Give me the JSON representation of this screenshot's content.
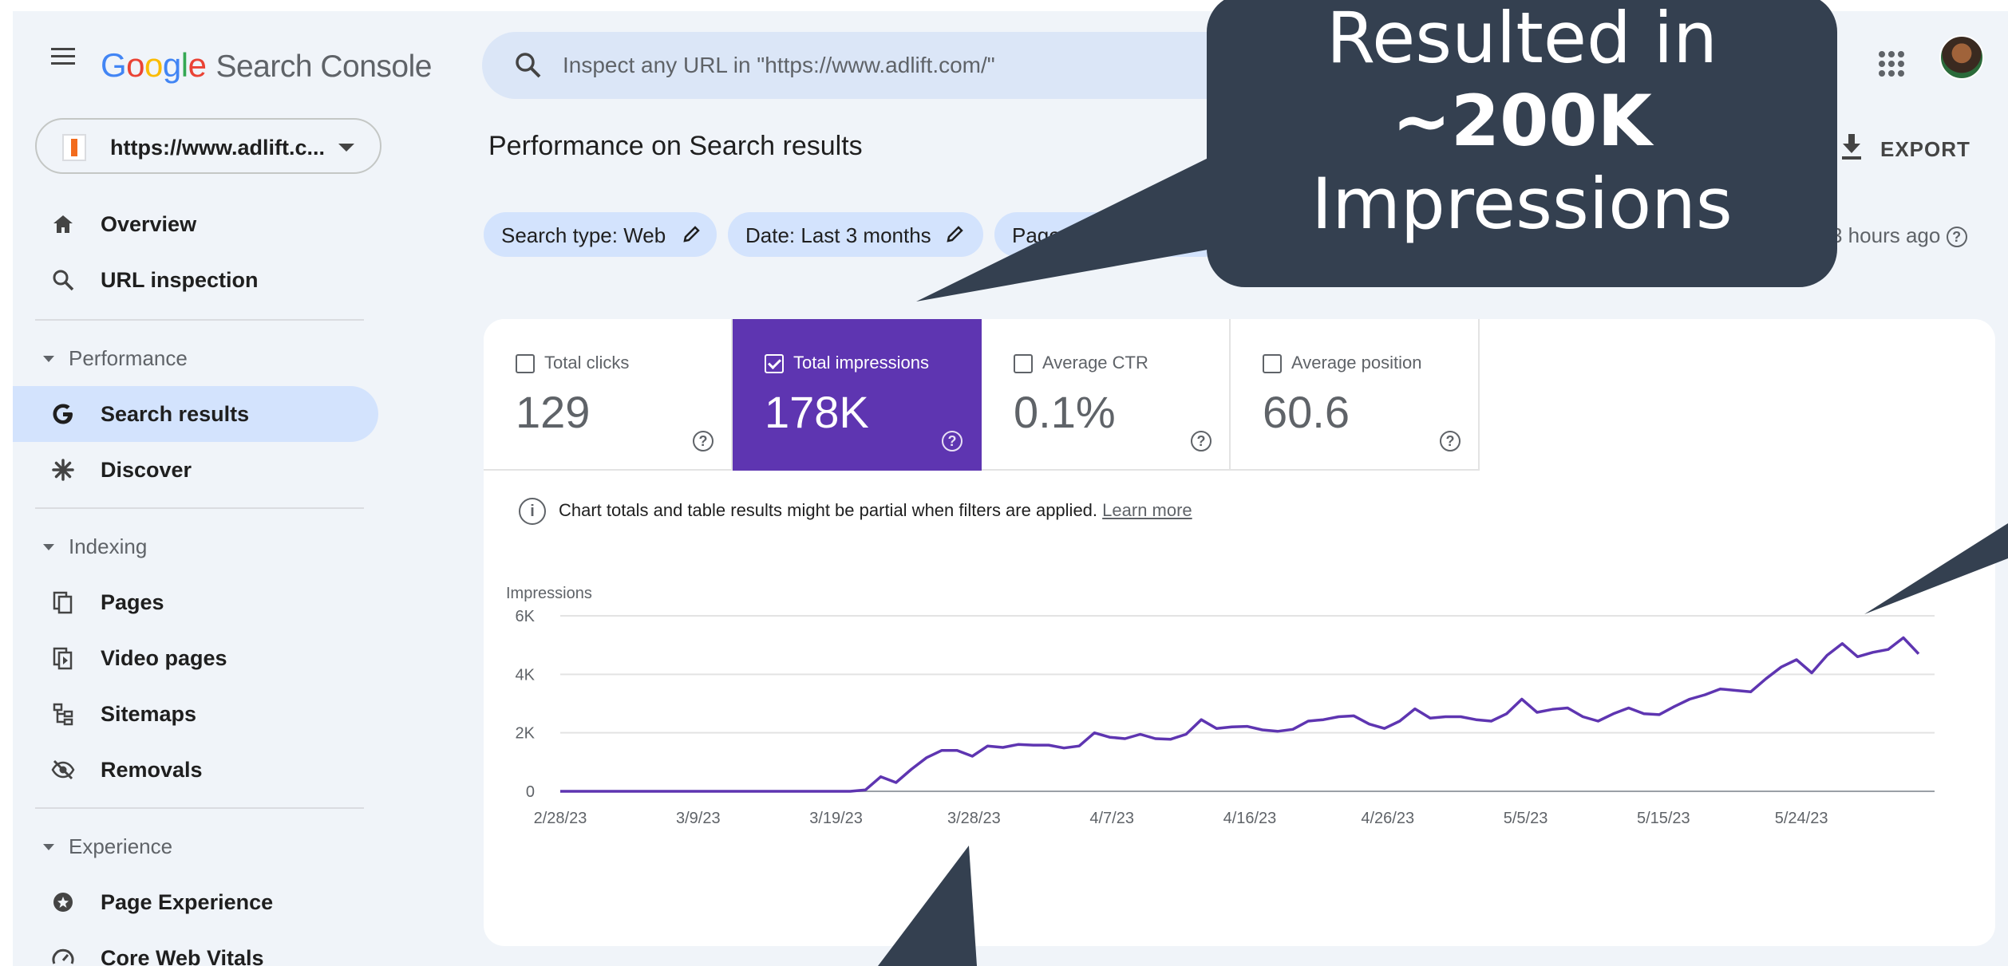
{
  "header": {
    "logo_letters": [
      "G",
      "o",
      "o",
      "g",
      "l",
      "e"
    ],
    "product": "Search Console",
    "search_placeholder": "Inspect any URL in \"https://www.adlift.com/\""
  },
  "property": {
    "label": "https://www.adlift.c..."
  },
  "sidebar": {
    "top_items": [
      {
        "label": "Overview",
        "icon": "home-icon"
      },
      {
        "label": "URL inspection",
        "icon": "search-icon"
      }
    ],
    "sections": [
      {
        "title": "Performance",
        "items": [
          {
            "label": "Search results",
            "icon": "google-g-icon",
            "active": true
          },
          {
            "label": "Discover",
            "icon": "asterisk-icon"
          }
        ]
      },
      {
        "title": "Indexing",
        "items": [
          {
            "label": "Pages",
            "icon": "pages-icon"
          },
          {
            "label": "Video pages",
            "icon": "video-pages-icon"
          },
          {
            "label": "Sitemaps",
            "icon": "sitemap-icon"
          },
          {
            "label": "Removals",
            "icon": "eye-off-icon"
          }
        ]
      },
      {
        "title": "Experience",
        "items": [
          {
            "label": "Page Experience",
            "icon": "page-experience-icon"
          },
          {
            "label": "Core Web Vitals",
            "icon": "gauge-icon"
          }
        ]
      }
    ]
  },
  "main": {
    "title": "Performance on Search results",
    "export_label": "EXPORT",
    "filters": [
      {
        "label": "Search type: Web"
      },
      {
        "label": "Date: Last 3 months"
      },
      {
        "label": "Page:"
      }
    ],
    "updated": "3 hours ago",
    "metrics": [
      {
        "label": "Total clicks",
        "value": "129",
        "selected": false
      },
      {
        "label": "Total impressions",
        "value": "178K",
        "selected": true
      },
      {
        "label": "Average CTR",
        "value": "0.1%",
        "selected": false
      },
      {
        "label": "Average position",
        "value": "60.6",
        "selected": false
      }
    ],
    "info_text": "Chart totals and table results might be partial when filters are applied.",
    "learn_more": "Learn more"
  },
  "callout": {
    "line1": "Resulted in",
    "line2": "~200K",
    "line3": "Impressions"
  },
  "colors": {
    "accent": "#5e35b1",
    "callout_bg": "#344050",
    "active_nav": "#d3e3fd",
    "line": "#5e35b1"
  },
  "chart_data": {
    "type": "line",
    "ylabel": "Impressions",
    "yticks": [
      "0",
      "2K",
      "4K",
      "6K"
    ],
    "ylim": [
      0,
      6000
    ],
    "xticks": [
      "2/28/23",
      "3/9/23",
      "3/19/23",
      "3/28/23",
      "4/7/23",
      "4/16/23",
      "4/26/23",
      "5/5/23",
      "5/15/23",
      "5/24/23"
    ],
    "grid": true,
    "series": [
      {
        "name": "Impressions",
        "values": [
          0,
          0,
          0,
          0,
          0,
          0,
          0,
          0,
          0,
          0,
          0,
          0,
          0,
          0,
          0,
          0,
          0,
          0,
          0,
          0,
          50,
          500,
          300,
          750,
          1150,
          1400,
          1400,
          1200,
          1550,
          1500,
          1600,
          1580,
          1580,
          1480,
          1550,
          2000,
          1850,
          1800,
          1950,
          1800,
          1780,
          1950,
          2450,
          2150,
          2200,
          2220,
          2100,
          2050,
          2120,
          2400,
          2450,
          2550,
          2580,
          2300,
          2150,
          2400,
          2820,
          2500,
          2550,
          2550,
          2450,
          2400,
          2650,
          3150,
          2700,
          2800,
          2850,
          2550,
          2400,
          2650,
          2850,
          2650,
          2620,
          2900,
          3150,
          3300,
          3500,
          3450,
          3400,
          3850,
          4250,
          4500,
          4050,
          4650,
          5050,
          4600,
          4750,
          4850,
          5250,
          4700
        ]
      }
    ]
  }
}
